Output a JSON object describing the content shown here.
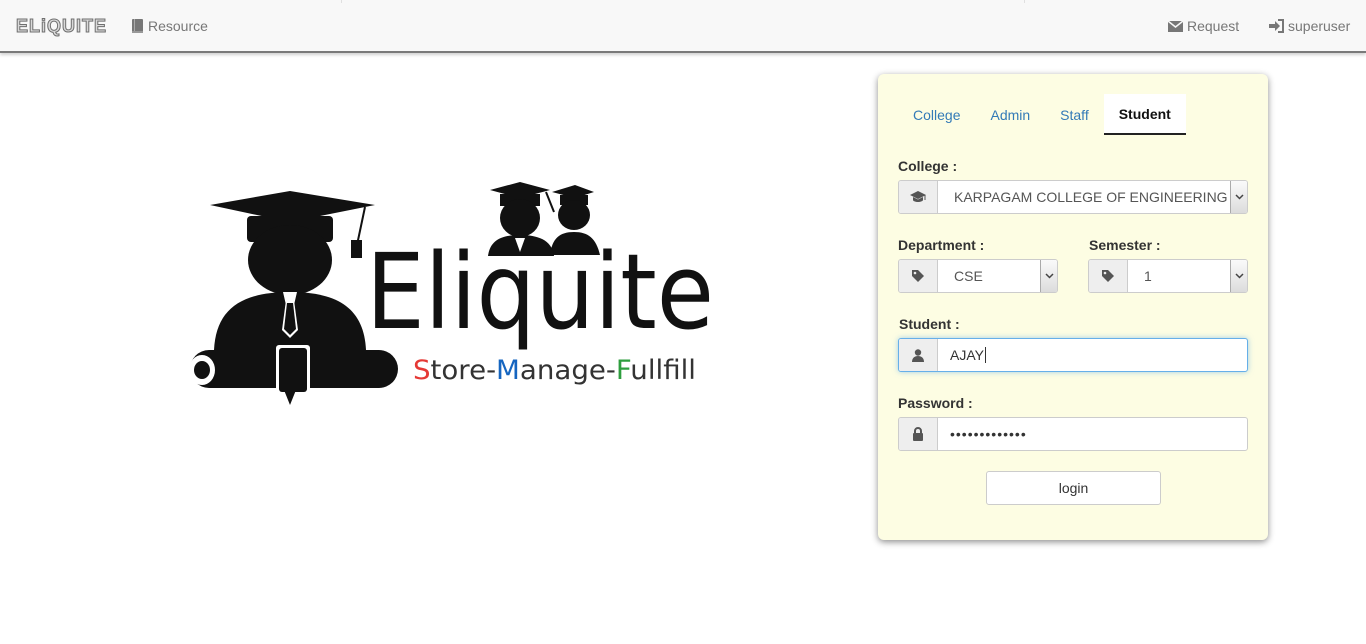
{
  "navbar": {
    "brand": "ELiQUITE",
    "resource_label": "Resource",
    "request_label": "Request",
    "user_label": "superuser",
    "icons": {
      "resource": "book-icon",
      "request": "envelope-icon",
      "user": "log-in-icon"
    }
  },
  "logo": {
    "wordmark": "Eliquite",
    "tagline": {
      "s": "S",
      "tore": "tore-",
      "m": "M",
      "anage": "anage-",
      "f": "F",
      "ullfill": "ullfill"
    },
    "colors": {
      "s": "#e53935",
      "m": "#1565c0",
      "f": "#2e9e3e",
      "text": "#333333"
    }
  },
  "login": {
    "tabs": [
      {
        "label": "College",
        "active": false
      },
      {
        "label": "Admin",
        "active": false
      },
      {
        "label": "Staff",
        "active": false
      },
      {
        "label": "Student",
        "active": true
      }
    ],
    "college": {
      "label": "College :",
      "value": "KARPAGAM COLLEGE OF ENGINEERING",
      "icon": "graduation-cap-icon"
    },
    "department": {
      "label": "Department :",
      "value": "CSE",
      "icon": "tag-icon"
    },
    "semester": {
      "label": "Semester :",
      "value": "1",
      "icon": "tag-icon"
    },
    "student": {
      "label": "Student :",
      "value": "AJAY",
      "icon": "user-icon"
    },
    "password": {
      "label": "Password :",
      "value": "•••••••••••••",
      "icon": "lock-icon"
    },
    "login_button": "login"
  },
  "colors": {
    "panel_bg": "#fdfde3",
    "tab_link": "#337ab7",
    "focus": "#66afe9"
  }
}
